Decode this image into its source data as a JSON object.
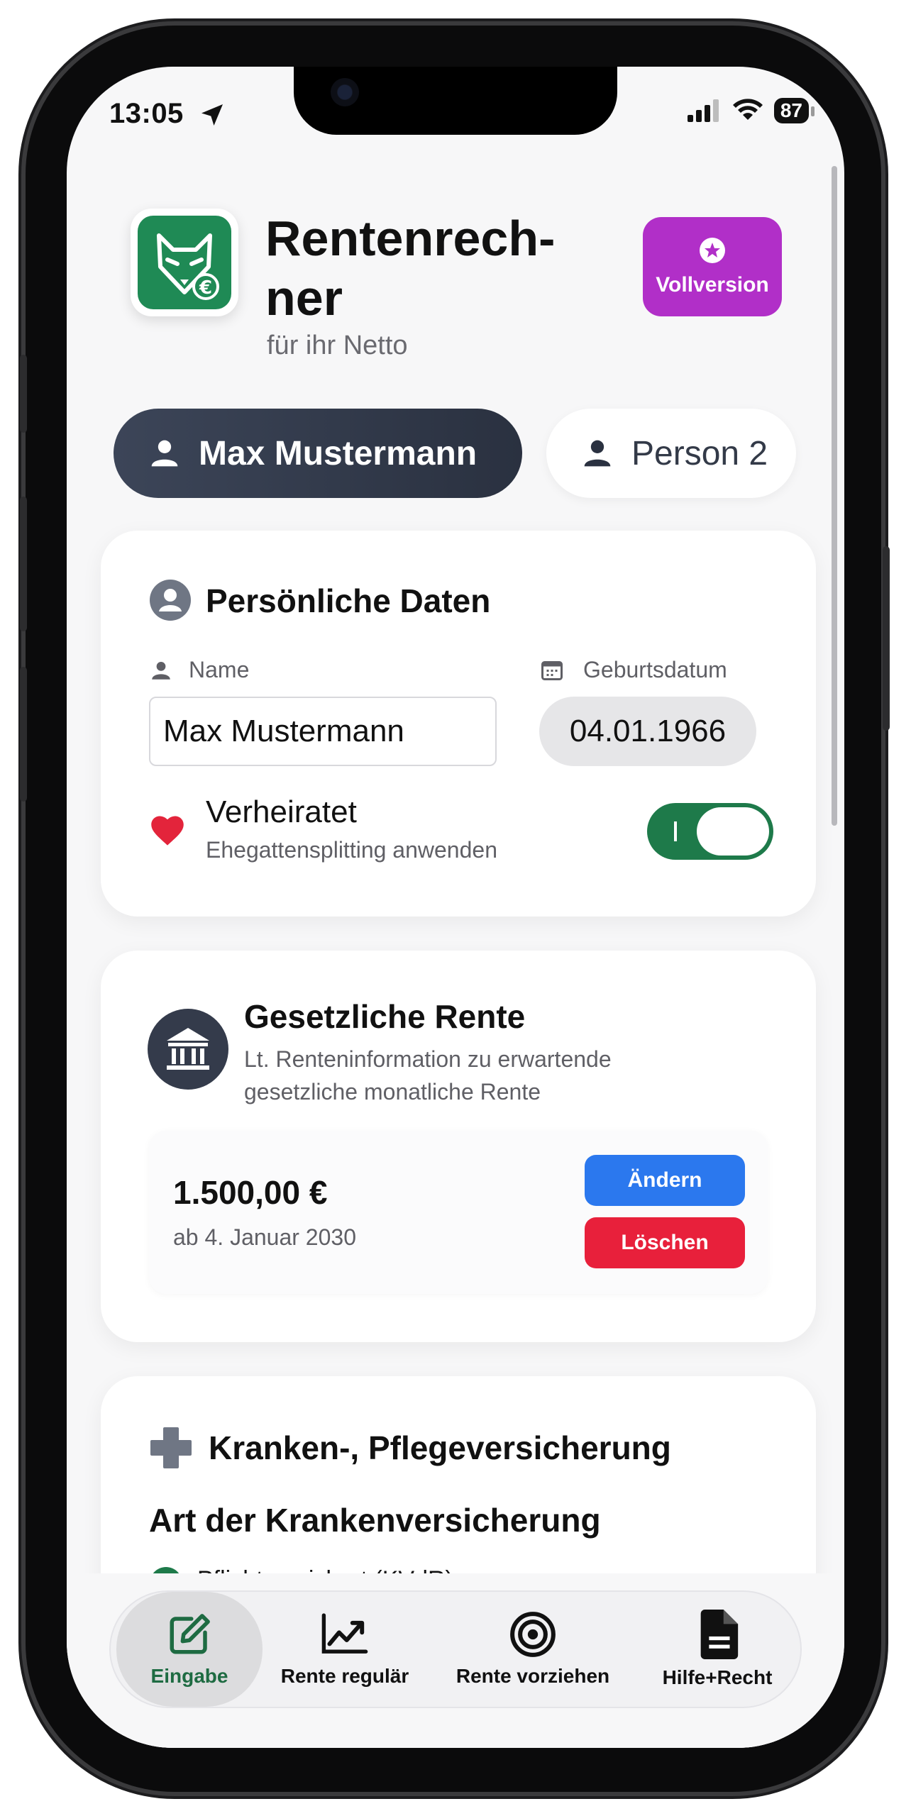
{
  "status": {
    "time": "13:05",
    "battery": "87"
  },
  "header": {
    "title": "Rentenrech-\nner",
    "subtitle": "für ihr Netto",
    "pro_label": "Vollversion"
  },
  "person_tabs": [
    {
      "label": "Max Mustermann"
    },
    {
      "label": "Person 2"
    }
  ],
  "personal": {
    "title": "Persönliche Daten",
    "name_label": "Name",
    "name_value": "Max Mustermann",
    "birth_label": "Geburtsdatum",
    "birth_value": "04.01.1966",
    "married_label": "Verheiratet",
    "married_sub": "Ehegattensplitting anwenden",
    "married_on": true
  },
  "pension": {
    "title": "Gesetzliche Rente",
    "subtitle": "Lt. Renteninformation zu erwartende gesetzliche monatliche Rente",
    "amount": "1.500,00 €",
    "start": "ab 4. Januar 2030",
    "edit_label": "Ändern",
    "delete_label": "Löschen"
  },
  "insurance": {
    "title": "Kranken-, Pflegeversicherung",
    "section": "Art der Krankenversicherung",
    "option": "Pflichtversichert (KVdR)"
  },
  "nav": [
    {
      "label": "Eingabe",
      "icon": "edit-icon"
    },
    {
      "label": "Rente regulär",
      "icon": "chart-line-icon"
    },
    {
      "label": "Rente vorziehen",
      "icon": "target-icon"
    },
    {
      "label": "Hilfe+Recht",
      "icon": "document-icon"
    }
  ],
  "colors": {
    "accent_green": "#1e7a4a",
    "pro_purple": "#b12fc8",
    "edit_blue": "#2b78ee",
    "delete_red": "#e8203b"
  }
}
